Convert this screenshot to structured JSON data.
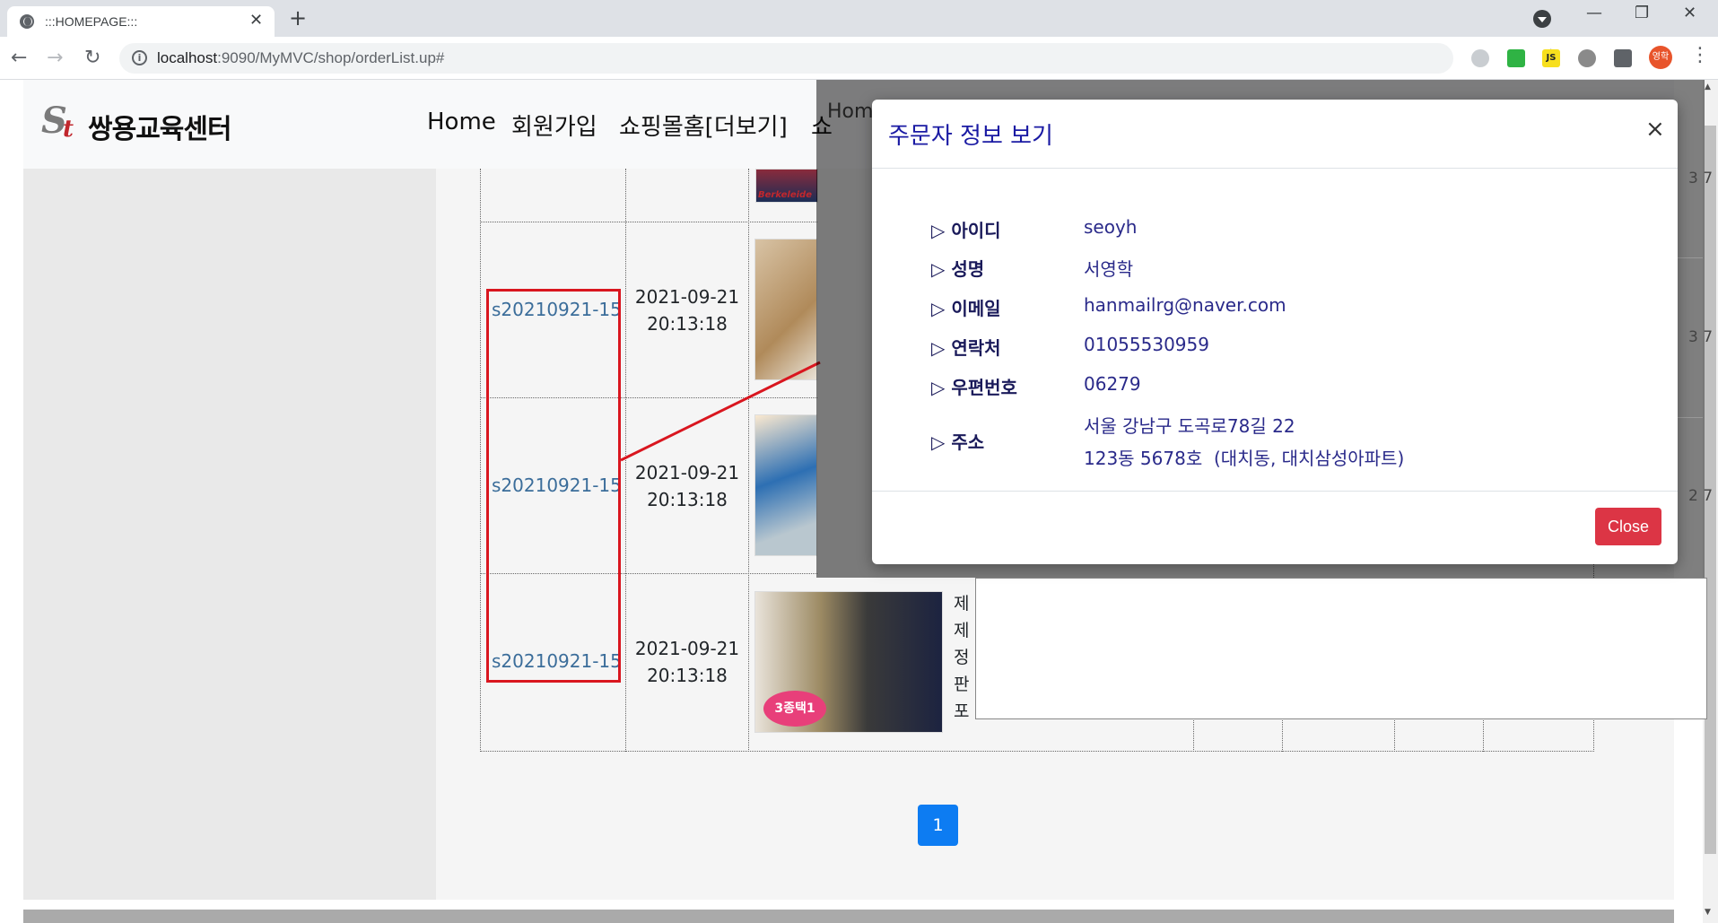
{
  "browser": {
    "tab_title": ":::HOMEPAGE:::",
    "url_host": "localhost",
    "url_rest": ":9090/MyMVC/shop/orderList.up#",
    "avatar_label": "영학"
  },
  "site": {
    "logo_text": "쌍용교육센터",
    "nav": [
      "Home",
      "회원가입",
      "쇼핑몰홈[더보기]"
    ],
    "nav_partial": "쇼"
  },
  "orders": [
    {
      "order_no": "s20210921-15",
      "date": "2021-09-21",
      "time": "20:13:18"
    },
    {
      "order_no": "s20210921-15",
      "date": "2021-09-21",
      "time": "20:13:18"
    },
    {
      "order_no": "s20210921-15",
      "date": "2021-09-21",
      "time": "20:13:18"
    }
  ],
  "product_desc_partial": [
    "제",
    "제",
    "정",
    "판",
    "포"
  ],
  "pagination": {
    "current": "1"
  },
  "background": {
    "partial_text": "Hom",
    "right_numbers": [
      "3 7",
      "3 7",
      "2 7"
    ]
  },
  "modal": {
    "title": "주문자 정보 보기",
    "close_x": "×",
    "close_button": "Close",
    "rows": [
      {
        "label": "▷ 아이디",
        "value": "seoyh"
      },
      {
        "label": "▷ 성명",
        "value": "서영학"
      },
      {
        "label": "▷ 이메일",
        "value": "hanmailrg@naver.com"
      },
      {
        "label": "▷ 연락처",
        "value": "01055530959"
      },
      {
        "label": "▷ 우편번호",
        "value": "06279"
      }
    ],
    "address": {
      "label": "▷ 주소",
      "line1": "서울 강남구 도곡로78길 22",
      "line2": "123동 5678호  (대치동, 대치삼성아파트)"
    }
  }
}
